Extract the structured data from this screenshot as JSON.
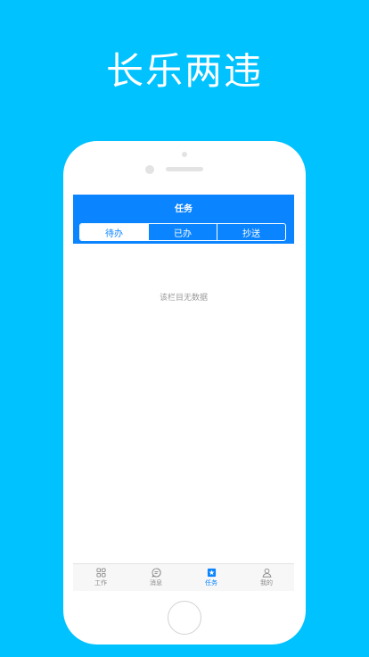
{
  "promo": {
    "title": "长乐两违"
  },
  "app": {
    "header_title": "任务",
    "segments": [
      {
        "label": "待办",
        "active": true
      },
      {
        "label": "已办",
        "active": false
      },
      {
        "label": "抄送",
        "active": false
      }
    ],
    "empty_message": "该栏目无数据",
    "tabbar": [
      {
        "label": "工作",
        "icon": "grid-icon",
        "active": false
      },
      {
        "label": "消息",
        "icon": "chat-bubble-icon",
        "active": false
      },
      {
        "label": "任务",
        "icon": "task-star-icon",
        "active": true
      },
      {
        "label": "我的",
        "icon": "person-icon",
        "active": false
      }
    ]
  },
  "colors": {
    "background": "#00c2ff",
    "primary": "#0a84ff",
    "inactive": "#8a8a8a"
  }
}
